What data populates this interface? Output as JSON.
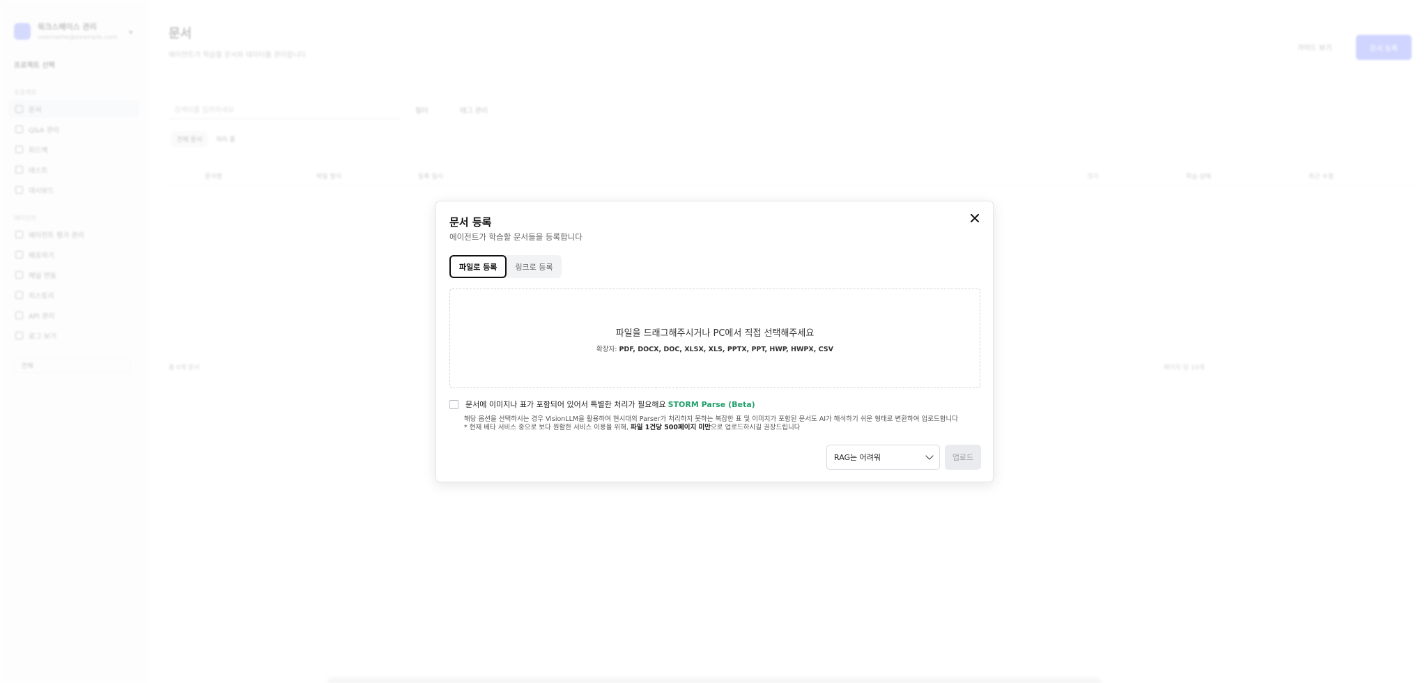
{
  "background": {
    "workspace_name": "워크스페이스 관리",
    "workspace_email": "username@example.com",
    "project_label": "프로젝트 선택",
    "section_label_1": "프로젝트",
    "nav_items": [
      "문서",
      "Q&A 관리",
      "피드백",
      "테스트",
      "대시보드"
    ],
    "section_label_2": "에이전트",
    "nav_items_2": [
      "에이전트 평가 관리",
      "배포하기",
      "채널 연동",
      "히스토리",
      "API 관리",
      "로그 보기"
    ],
    "filter_label": "전체",
    "page_title": "문서",
    "page_subtitle": "에이전트가 학습할 문서와 데이터를 관리합니다",
    "guide_label": "가이드 보기",
    "register_label": "문서 등록",
    "search_placeholder": "검색어를 입력하세요",
    "chip_filter": "필터",
    "chip_tag": "태그 관리",
    "seg_all": "전체 문서",
    "seg_processing": "처리 중",
    "columns": [
      "문서명",
      "파일 형식",
      "등록 일시",
      "크기",
      "학습 상태",
      "최근 수정"
    ],
    "pager_left": "총 0개 문서",
    "pager_right": "페이지 당 10개"
  },
  "modal": {
    "title": "문서 등록",
    "subtitle": "에이전트가 학습할 문서들을 등록합니다",
    "tabs": [
      {
        "label": "파일로 등록",
        "active": true
      },
      {
        "label": "링크로 등록",
        "active": false
      }
    ],
    "dropzone": {
      "main_text": "파일을 드래그해주시거나 PC에서 직접 선택해주세요",
      "ext_prefix": "확장자:",
      "ext_list": "PDF, DOCX, DOC, XLSX, XLS, PPTX, PPT, HWP, HWPX, CSV"
    },
    "option": {
      "label": "문서에 이미지나 표가 포함되어 있어서 특별한 처리가 필요해요",
      "highlight": "STORM Parse (Beta)",
      "description": "해당 옵션을 선택하시는 경우 VisionLLM을 활용하여 현시대의 Parser가 처리하지 못하는 복잡한 표 및 이미지가 포함된 문서도 AI가 해석하기 쉬운 형태로 변환하여 업로드합니다",
      "note_prefix": "* 현재 베타 서비스 중으로 보다 원활한 서비스 이용을 위해,",
      "note_bold": "파일 1건당 500페이지 미만",
      "note_suffix": "으로 업로드하시길 권장드립니다"
    },
    "select_value": "RAG는 어려워",
    "upload_label": "업로드"
  },
  "colors": {
    "accent_green": "#22a06b",
    "primary": "#5b6cff"
  }
}
